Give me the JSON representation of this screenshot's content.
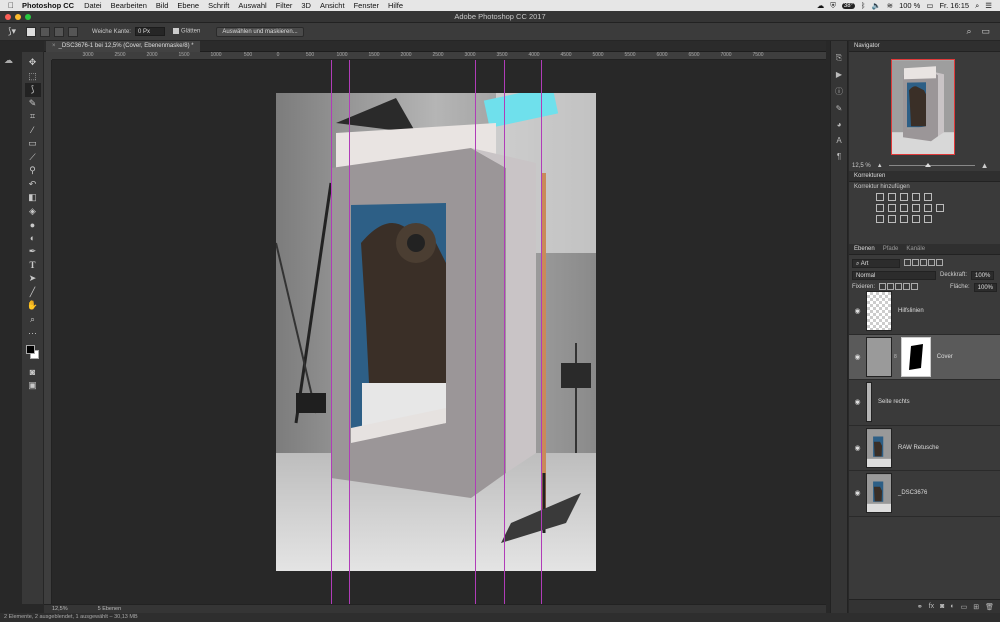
{
  "menubar": {
    "apple": "",
    "app": "Photoshop CC",
    "items": [
      "Datei",
      "Bearbeiten",
      "Bild",
      "Ebene",
      "Schrift",
      "Auswahl",
      "Filter",
      "3D",
      "Ansicht",
      "Fenster",
      "Hilfe"
    ],
    "temp": "38°",
    "battery": "100 %",
    "time": "Fr. 16:15"
  },
  "window": {
    "title": "Adobe Photoshop CC 2017"
  },
  "options": {
    "feather_label": "Weiche Kante:",
    "feather_value": "0 Px",
    "antialias_label": "Glätten",
    "select_mask_button": "Auswählen und maskieren..."
  },
  "document": {
    "tab_title": "_DSC3676-1 bei 12,5% (Cover, Ebenenmaske/8) *"
  },
  "ruler": {
    "h_ticks": [
      "3000",
      "2500",
      "2000",
      "1500",
      "1000",
      "500",
      "0",
      "500",
      "1000",
      "1500",
      "2000",
      "2500",
      "3000",
      "3500",
      "4000",
      "4500",
      "5000",
      "5500",
      "6000",
      "6500",
      "7000",
      "7500"
    ]
  },
  "status": {
    "zoom": "12,5%",
    "layers_count": "5 Ebenen",
    "bottom": "2 Elemente, 2 ausgeblendet, 1 ausgewählt – 30,13 MB"
  },
  "panels": {
    "navigator": {
      "tab": "Navigator",
      "zoom": "12,5 %"
    },
    "adjustments": {
      "tab": "Korrekturen",
      "add_label": "Korrektur hinzufügen"
    },
    "layers_tabs": [
      "Ebenen",
      "Pfade",
      "Kanäle"
    ],
    "filter_kind": "Art",
    "blend_mode": "Normal",
    "opacity_label": "Deckkraft:",
    "opacity_value": "100%",
    "lock_label": "Fixieren:",
    "fill_label": "Fläche:",
    "fill_value": "100%"
  },
  "layers": [
    {
      "name": "Hilfslinien"
    },
    {
      "name": "Cover"
    },
    {
      "name": "Seite rechts"
    },
    {
      "name": "RAW Retusche"
    },
    {
      "name": "_DSC3676"
    }
  ],
  "colors": {
    "guides": "#b03cb8",
    "navigator_frame": "#e03a3a",
    "ui_dark": "#282828"
  }
}
